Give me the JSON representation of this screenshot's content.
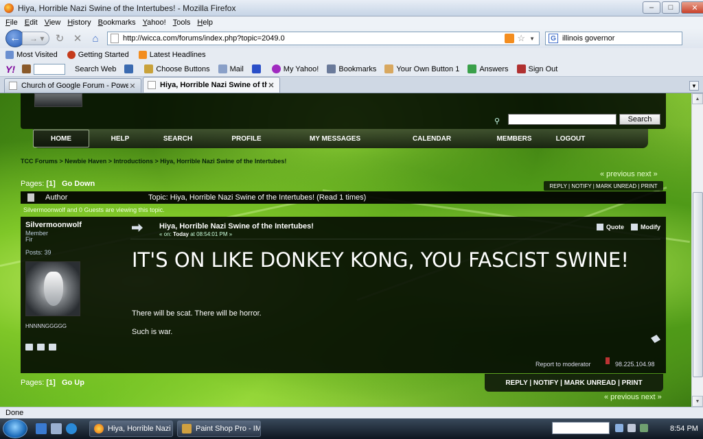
{
  "window": {
    "title": "Hiya, Horrible Nazi Swine of the Intertubes! - Mozilla Firefox"
  },
  "menu": [
    "File",
    "Edit",
    "View",
    "History",
    "Bookmarks",
    "Yahoo!",
    "Tools",
    "Help"
  ],
  "nav": {
    "url": "http://wicca.com/forums/index.php?topic=2049.0",
    "search_value": "illinois governor"
  },
  "bookmarks": [
    "Most Visited",
    "Getting Started",
    "Latest Headlines"
  ],
  "yahoo": {
    "logo": "Y!",
    "search_web": "Search Web",
    "choose_buttons": "Choose Buttons",
    "mail": "Mail",
    "my_yahoo": "My Yahoo!",
    "bookmarks": "Bookmarks",
    "own_button": "Your Own Button 1",
    "answers": "Answers",
    "sign_out": "Sign Out"
  },
  "tabs": [
    {
      "label": "Church of Google Forum - Powered..."
    },
    {
      "label": "Hiya, Horrible Nazi Swine of the I..."
    }
  ],
  "forum": {
    "search_button": "Search",
    "menu": [
      "HOME",
      "HELP",
      "SEARCH",
      "PROFILE",
      "MY MESSAGES",
      "CALENDAR",
      "MEMBERS",
      "LOGOUT"
    ],
    "breadcrumb": "TCC Forums > Newbie Haven > Introductions > Hiya, Horrible Nazi Swine of the Intertubes!",
    "prev_next": "« previous next »",
    "pages_label": "Pages:",
    "pages_value": "[1]",
    "go_down": "Go Down",
    "go_up": "Go Up",
    "actions_small": "REPLY | NOTIFY | MARK UNREAD | PRINT",
    "actions_big": "REPLY | NOTIFY | MARK UNREAD | PRINT",
    "author_label": "Author",
    "topic_label": "Topic: Hiya, Horrible Nazi Swine of the Intertubes!  (Read 1 times)",
    "viewing": "Silvermoonwolf and 0 Guests are viewing this topic."
  },
  "post": {
    "poster_name": "Silvermoonwolf",
    "poster_rank": "Member",
    "poster_sub": "Fir",
    "poster_posts": "Posts: 39",
    "poster_tag": "HNNNNGGGGG",
    "subject": "Hiya, Horrible Nazi Swine of the Intertubes!",
    "date_prefix": "« on:",
    "date_bold": "Today",
    "date_rest": "at 08:54:01 PM »",
    "quote": "Quote",
    "modify": "Modify",
    "headline": "IT'S ON LIKE DONKEY KONG, YOU FASCIST SWINE!",
    "body1": "There will be scat.  There will be horror.",
    "body2": "Such is war.",
    "report": "Report to moderator",
    "ip": "98.225.104.98"
  },
  "status": "Done",
  "taskbar": {
    "task1": "Hiya, Horrible Nazi ...",
    "task2": "Paint Shop Pro - IM...",
    "clock": "8:54 PM"
  }
}
